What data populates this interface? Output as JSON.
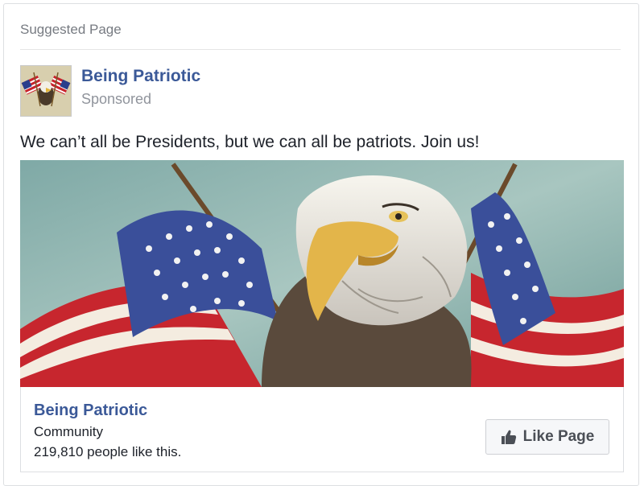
{
  "card": {
    "header": "Suggested Page",
    "page_name": "Being Patriotic",
    "sponsored": "Sponsored",
    "post_text": "We can’t all be Presidents, but we can all be patriots. Join us!"
  },
  "attachment": {
    "title": "Being Patriotic",
    "category": "Community",
    "likes": "219,810 people like this.",
    "like_button": "Like Page"
  },
  "icons": {
    "like_button_icon": "thumbs-up-icon",
    "avatar": "eagle-flags-icon"
  },
  "colors": {
    "link_blue": "#3b5998",
    "secondary_text": "#90949c",
    "button_bg": "#f6f7f9"
  }
}
